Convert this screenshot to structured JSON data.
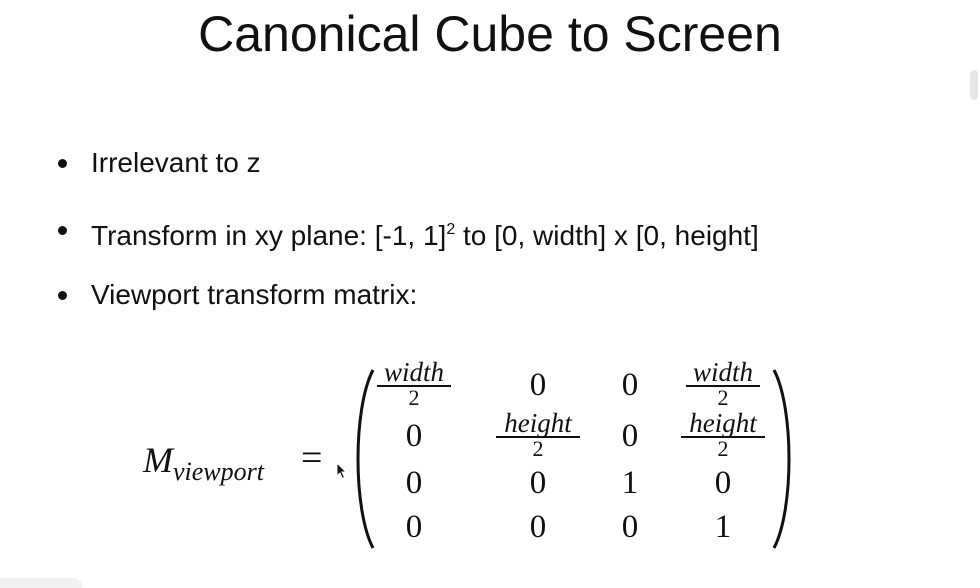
{
  "slide": {
    "title": "Canonical Cube to Screen",
    "bullets": {
      "b1": "Irrelevant to z",
      "b2_pre": "Transform in xy plane: [-1, 1]",
      "b2_sup": "2",
      "b2_post": " to [0, width] x [0, height]",
      "b3": "Viewport transform matrix:"
    },
    "matrix": {
      "lhs_main": "M",
      "lhs_sub": "viewport",
      "equals": "=",
      "rows": [
        [
          {
            "num": "width",
            "den": "2"
          },
          "0",
          "0",
          {
            "num": "width",
            "den": "2"
          }
        ],
        [
          "0",
          {
            "num": "height",
            "den": "2"
          },
          "0",
          {
            "num": "height",
            "den": "2"
          }
        ],
        [
          "0",
          "0",
          "1",
          "0"
        ],
        [
          "0",
          "0",
          "0",
          "1"
        ]
      ]
    }
  }
}
